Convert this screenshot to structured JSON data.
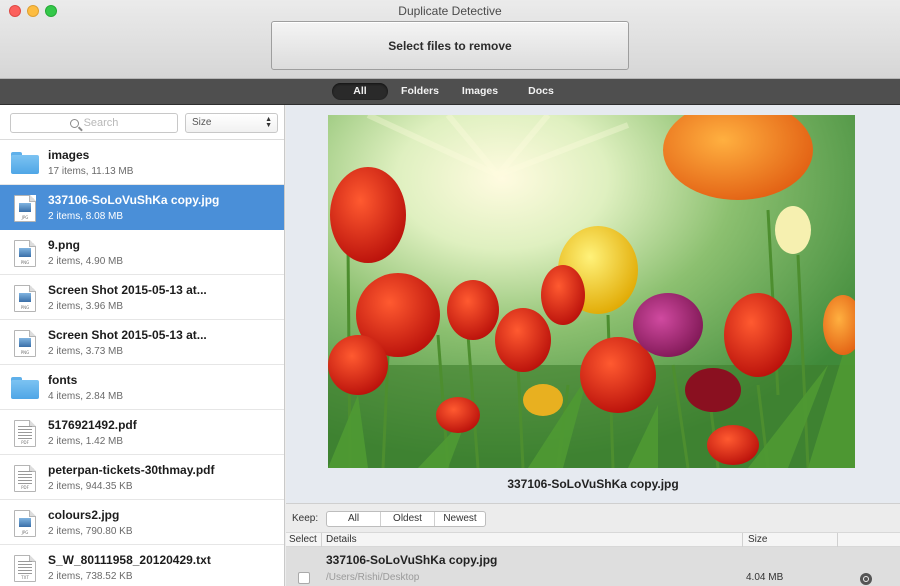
{
  "window": {
    "title": "Duplicate Detective"
  },
  "toolbar": {
    "select_button": "Select files to remove"
  },
  "filters": [
    {
      "label": "All",
      "active": true
    },
    {
      "label": "Folders",
      "active": false
    },
    {
      "label": "Images",
      "active": false
    },
    {
      "label": "Docs",
      "active": false
    }
  ],
  "sidebar": {
    "search_placeholder": "Search",
    "sort_value": "Size",
    "items": [
      {
        "name": "images",
        "meta": "17 items, 11.13 MB",
        "icon": "folder-icon",
        "selected": false
      },
      {
        "name": "337106-SoLoVuShKa copy.jpg",
        "meta": "2 items, 8.08 MB",
        "icon": "image-file-icon",
        "selected": true
      },
      {
        "name": "9.png",
        "meta": "2 items, 4.90 MB",
        "icon": "image-file-icon",
        "selected": false
      },
      {
        "name": "Screen Shot 2015-05-13 at...",
        "meta": "2 items, 3.96 MB",
        "icon": "image-file-icon",
        "selected": false
      },
      {
        "name": "Screen Shot 2015-05-13 at...",
        "meta": "2 items, 3.73 MB",
        "icon": "image-file-icon",
        "selected": false
      },
      {
        "name": "fonts",
        "meta": "4 items, 2.84 MB",
        "icon": "folder-icon",
        "selected": false
      },
      {
        "name": "5176921492.pdf",
        "meta": "2 items, 1.42 MB",
        "icon": "pdf-file-icon",
        "selected": false
      },
      {
        "name": "peterpan-tickets-30thmay.pdf",
        "meta": "2 items, 944.35 KB",
        "icon": "pdf-file-icon",
        "selected": false
      },
      {
        "name": "colours2.jpg",
        "meta": "2 items, 790.80 KB",
        "icon": "image-file-icon",
        "selected": false
      },
      {
        "name": "S_W_80111958_20120429.txt",
        "meta": "2 items, 738.52 KB",
        "icon": "text-file-icon",
        "selected": false
      }
    ]
  },
  "preview": {
    "caption": "337106-SoLoVuShKa copy.jpg"
  },
  "keep": {
    "label": "Keep:",
    "options": [
      "All",
      "Oldest",
      "Newest"
    ]
  },
  "table": {
    "headers": {
      "select": "Select",
      "details": "Details",
      "size": "Size"
    },
    "rows": [
      {
        "name": "337106-SoLoVuShKa copy.jpg",
        "path": "/Users/Rishi/Desktop",
        "size": "4.04 MB"
      }
    ]
  },
  "colors": {
    "selection": "#4a8fd8",
    "filterbar": "#4f4f4f"
  }
}
